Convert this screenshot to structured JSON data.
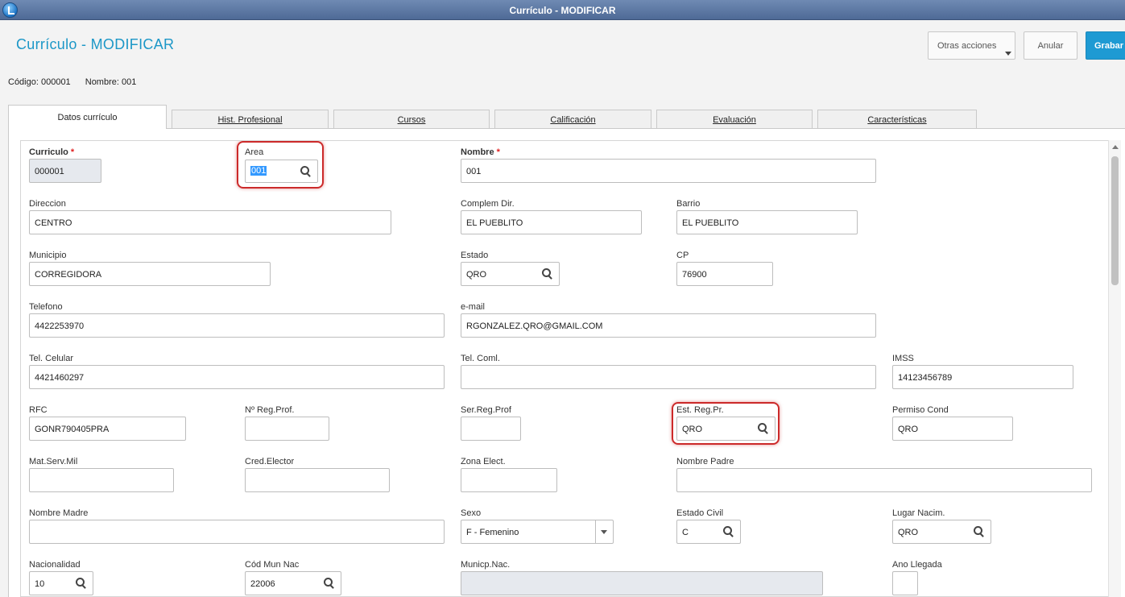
{
  "window": {
    "title": "Currículo - MODIFICAR"
  },
  "header": {
    "page_title": "Currículo - MODIFICAR",
    "buttons": {
      "otras_acciones": "Otras acciones",
      "anular": "Anular",
      "grabar": "Grabar"
    }
  },
  "info": {
    "codigo": "Código: 000001",
    "nombre": "Nombre: 001"
  },
  "tabs": [
    {
      "label": "Datos currículo",
      "active": true
    },
    {
      "label": "Hist. Profesional",
      "active": false
    },
    {
      "label": "Cursos",
      "active": false
    },
    {
      "label": "Calificación",
      "active": false
    },
    {
      "label": "Evaluación",
      "active": false
    },
    {
      "label": "Características",
      "active": false
    }
  ],
  "fields": {
    "curriculo": {
      "label": "Curriculo",
      "required_mark": "*",
      "value": "000001"
    },
    "area": {
      "label": "Area",
      "value": "001"
    },
    "nombre": {
      "label": "Nombre",
      "required_mark": "*",
      "value": "001"
    },
    "direccion": {
      "label": "Direccion",
      "value": "CENTRO"
    },
    "complem_dir": {
      "label": "Complem Dir.",
      "value": "EL PUEBLITO"
    },
    "barrio": {
      "label": "Barrio",
      "value": "EL PUEBLITO"
    },
    "municipio": {
      "label": "Municipio",
      "value": "CORREGIDORA"
    },
    "estado": {
      "label": "Estado",
      "value": "QRO"
    },
    "cp": {
      "label": "CP",
      "value": "76900"
    },
    "telefono": {
      "label": "Telefono",
      "value": "4422253970"
    },
    "email": {
      "label": "e-mail",
      "value": "RGONZALEZ.QRO@GMAIL.COM"
    },
    "tel_celular": {
      "label": "Tel. Celular",
      "value": "4421460297"
    },
    "tel_coml": {
      "label": "Tel. Coml.",
      "value": ""
    },
    "imss": {
      "label": "IMSS",
      "value": "14123456789"
    },
    "rfc": {
      "label": "RFC",
      "value": "GONR790405PRA"
    },
    "n_reg_prof": {
      "label": "Nº Reg.Prof.",
      "value": ""
    },
    "ser_reg_prof": {
      "label": "Ser.Reg.Prof",
      "value": ""
    },
    "est_reg_pr": {
      "label": "Est. Reg.Pr.",
      "value": "QRO"
    },
    "permiso_cond": {
      "label": "Permiso Cond",
      "value": "QRO"
    },
    "mat_serv_mil": {
      "label": "Mat.Serv.Mil",
      "value": ""
    },
    "cred_elector": {
      "label": "Cred.Elector",
      "value": ""
    },
    "zona_elect": {
      "label": "Zona Elect.",
      "value": ""
    },
    "nombre_padre": {
      "label": "Nombre Padre",
      "value": ""
    },
    "nombre_madre": {
      "label": "Nombre Madre",
      "value": ""
    },
    "sexo": {
      "label": "Sexo",
      "value": "F - Femenino"
    },
    "estado_civil": {
      "label": "Estado Civil",
      "value": "C"
    },
    "lugar_nacim": {
      "label": "Lugar Nacim.",
      "value": "QRO"
    },
    "nacionalidad": {
      "label": "Nacionalidad",
      "value": "10"
    },
    "cod_mun_nac": {
      "label": "Cód Mun Nac",
      "value": "22006"
    },
    "municp_nac": {
      "label": "Municp.Nac.",
      "value": ""
    },
    "ano_llegada": {
      "label": "Ano Llegada",
      "value": ""
    }
  }
}
